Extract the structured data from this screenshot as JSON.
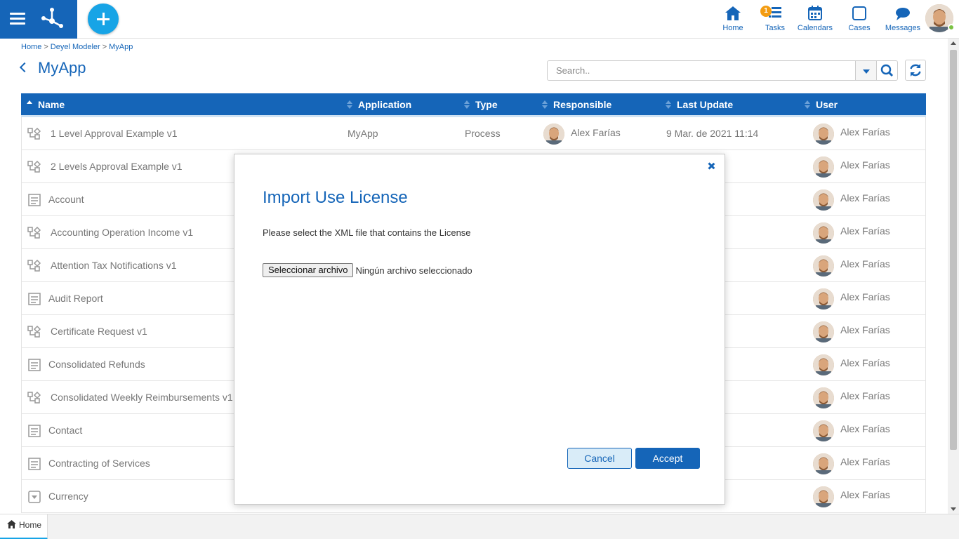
{
  "topbar": {
    "nav": [
      {
        "id": "home",
        "label": "Home",
        "icon": "home-icon"
      },
      {
        "id": "tasks",
        "label": "Tasks",
        "icon": "tasks-icon",
        "badge": "1"
      },
      {
        "id": "calendars",
        "label": "Calendars",
        "icon": "calendar-icon"
      },
      {
        "id": "cases",
        "label": "Cases",
        "icon": "cases-icon"
      },
      {
        "id": "messages",
        "label": "Messages",
        "icon": "messages-icon"
      }
    ],
    "accent": "#1565b8",
    "add_color": "#17a4e6"
  },
  "breadcrumb": {
    "items": [
      "Home",
      "Deyel Modeler",
      "MyApp"
    ],
    "separator": ">"
  },
  "page": {
    "title": "MyApp"
  },
  "search": {
    "placeholder": "Search.."
  },
  "table": {
    "headers": {
      "name": "Name",
      "application": "Application",
      "type": "Type",
      "responsible": "Responsible",
      "last_update": "Last Update",
      "user": "User"
    },
    "rows": [
      {
        "icon": "process-icon",
        "name": "1 Level Approval Example v1",
        "application": "MyApp",
        "type": "Process",
        "responsible": "Alex Farías",
        "last_update": "9 Mar. de 2021 11:14",
        "user": "Alex Farías"
      },
      {
        "icon": "process-icon",
        "name": "2 Levels Approval Example v1",
        "application": "",
        "type": "",
        "responsible": "",
        "last_update": ") 11:23",
        "user": "Alex Farías"
      },
      {
        "icon": "form-icon",
        "name": "Account",
        "application": "",
        "type": "",
        "responsible": "",
        "last_update": "21 10:18",
        "user": "Alex Farías"
      },
      {
        "icon": "process-icon",
        "name": "Accounting Operation Income v1",
        "application": "",
        "type": "",
        "responsible": "",
        "last_update": "1 10:26",
        "user": "Alex Farías"
      },
      {
        "icon": "process-icon",
        "name": "Attention Tax Notifications v1",
        "application": "",
        "type": "",
        "responsible": "",
        "last_update": "21 16:42",
        "user": "Alex Farías"
      },
      {
        "icon": "form-icon",
        "name": "Audit Report",
        "application": "",
        "type": "",
        "responsible": "",
        "last_update": "21 16:43",
        "user": "Alex Farías"
      },
      {
        "icon": "process-icon",
        "name": "Certificate Request v1",
        "application": "",
        "type": "",
        "responsible": "",
        "last_update": " 12:45",
        "user": "Alex Farías"
      },
      {
        "icon": "form-icon",
        "name": "Consolidated Refunds",
        "application": "",
        "type": "",
        "responsible": "",
        "last_update": "1 17:20",
        "user": "Alex Farías"
      },
      {
        "icon": "process-icon",
        "name": "Consolidated Weekly Reimbursements v1",
        "application": "",
        "type": "",
        "responsible": "",
        "last_update": "21 16:05",
        "user": "Alex Farías"
      },
      {
        "icon": "form-icon",
        "name": "Contact",
        "application": "",
        "type": "",
        "responsible": "",
        "last_update": "21 10:14",
        "user": "Alex Farías"
      },
      {
        "icon": "form-icon",
        "name": "Contracting of Services",
        "application": "",
        "type": "",
        "responsible": "",
        "last_update": "1 17:49",
        "user": "Alex Farías"
      },
      {
        "icon": "dropdown-list-icon",
        "name": "Currency",
        "application": "",
        "type": "",
        "responsible": "",
        "last_update": "21 17:24",
        "user": "Alex Farías"
      }
    ]
  },
  "modal": {
    "title": "Import Use License",
    "text": "Please select the XML file that contains the License",
    "file_button": "Seleccionar archivo",
    "file_status": "Ningún archivo seleccionado",
    "cancel_label": "Cancel",
    "accept_label": "Accept"
  },
  "bottom_tabs": {
    "home_label": "Home"
  }
}
